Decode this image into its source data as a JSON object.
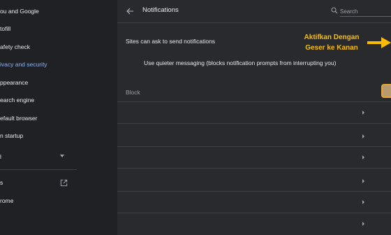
{
  "sidebar": {
    "items": [
      {
        "label": "ou and Google"
      },
      {
        "label": "tofill"
      },
      {
        "label": "afety check"
      },
      {
        "label": "ivacy and security"
      },
      {
        "label": "ppearance"
      },
      {
        "label": "earch engine"
      },
      {
        "label": "efault browser"
      },
      {
        "label": "n startup"
      },
      {
        "label": "l"
      },
      {
        "label": "s"
      },
      {
        "label": "rome"
      }
    ],
    "active_index": 3
  },
  "header": {
    "title": "Notifications",
    "search_placeholder": "Search"
  },
  "content": {
    "ask_label": "Sites can ask to send notifications",
    "quieter_label": "Use quieter messaging (blocks notification prompts from interrupting you)",
    "block_label": "Block"
  },
  "annotation": {
    "line1": "Aktifkan Dengan",
    "line2": "Geser ke Kanan"
  },
  "colors": {
    "accent": "#8ab4f8",
    "annotation": "#fbbc04",
    "background": "#202124",
    "panel": "#292a2d"
  },
  "icons": {
    "back": "arrow-left-icon",
    "search": "search-icon",
    "external": "open-in-new-icon",
    "caret": "chevron-down-icon",
    "row": "chevron-right-icon",
    "pointer": "arrow-right-icon"
  }
}
